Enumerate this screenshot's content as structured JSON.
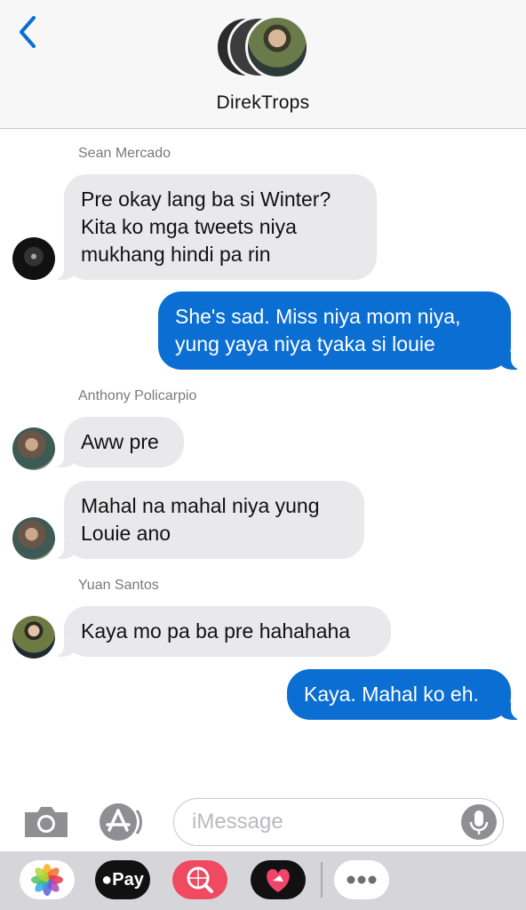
{
  "header": {
    "group_name": "DirekTrops"
  },
  "messages": [
    {
      "sender": "Sean Mercado",
      "text": "Pre okay lang ba si Winter?\nKita ko mga tweets niya\nmukhang hindi pa rin",
      "direction": "incoming"
    },
    {
      "sender": "",
      "text": "She's sad. Miss niya mom niya,\nyung yaya niya tyaka si louie",
      "direction": "outgoing"
    },
    {
      "sender": "Anthony Policarpio",
      "text": "Aww pre",
      "direction": "incoming"
    },
    {
      "sender": "",
      "text": "Mahal na mahal niya yung\nLouie ano",
      "direction": "incoming"
    },
    {
      "sender": "Yuan Santos",
      "text": "Kaya mo pa ba pre hahahaha",
      "direction": "incoming"
    },
    {
      "sender": "",
      "text": "Kaya. Mahal ko eh.",
      "direction": "outgoing"
    }
  ],
  "composer": {
    "placeholder": "iMessage",
    "value": ""
  },
  "app_tray": {
    "pay_label": "Pay",
    "icons": [
      "photos-icon",
      "apple-pay-icon",
      "search-images-icon",
      "heart-sticker-icon",
      "more-icon"
    ]
  },
  "colors": {
    "outgoing_bubble": "#0b6ed3",
    "incoming_bubble": "#e9e9eb",
    "accent": "#0b6ed3"
  }
}
